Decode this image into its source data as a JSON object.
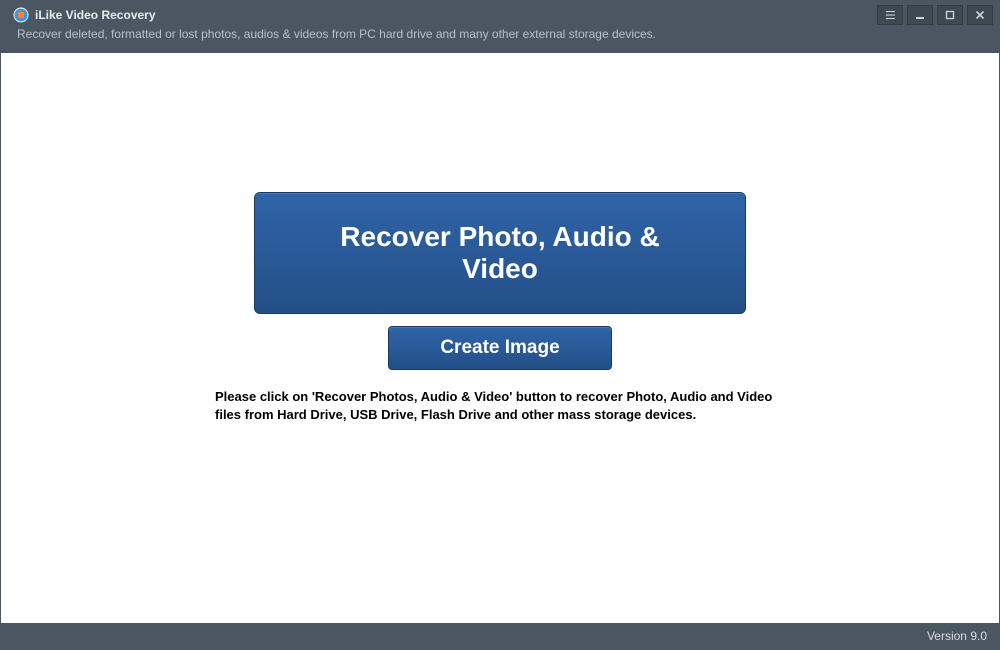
{
  "header": {
    "title": "iLike Video Recovery",
    "subtitle": "Recover deleted, formatted or lost photos, audios & videos from PC hard drive and many other external storage devices."
  },
  "main": {
    "recover_label": "Recover Photo, Audio & Video",
    "create_image_label": "Create Image",
    "instruction_text": "Please click on 'Recover Photos, Audio & Video' button to recover Photo, Audio and Video files from Hard Drive, USB Drive, Flash Drive and other mass storage devices."
  },
  "footer": {
    "version": "Version 9.0"
  }
}
